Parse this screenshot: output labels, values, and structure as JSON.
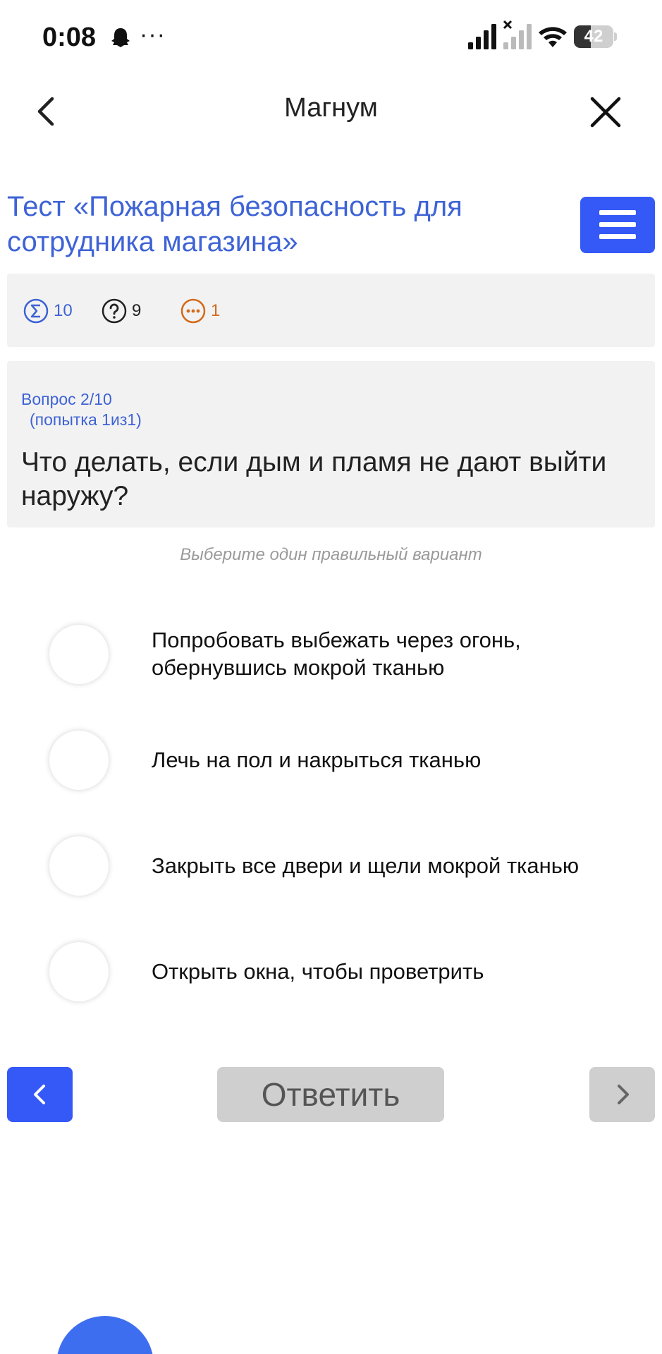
{
  "status_bar": {
    "time": "0:08",
    "more": "···",
    "battery_level": "42",
    "battery_fraction": 0.42,
    "icons": [
      "ghost-icon",
      "signal-icon",
      "no-signal-icon",
      "wifi-icon",
      "battery-icon"
    ]
  },
  "nav": {
    "title": "Магнум",
    "back_icon": "chevron-left-icon",
    "close_icon": "close-icon"
  },
  "test": {
    "title": " Тест «Пожарная безопасность для сотрудника магазина»",
    "menu_icon": "hamburger-icon"
  },
  "stats": {
    "total": "10",
    "unanswered": "9",
    "remaining": "1",
    "colors": {
      "total": "#3e63d6",
      "unanswered": "#222222",
      "remaining": "#d36a1a"
    }
  },
  "question": {
    "number": "Вопрос 2/10",
    "attempt": "(попытка 1из1)",
    "text": "Что делать, если дым и пламя не дают выйти наружу?"
  },
  "hint": "Выберите один правильный вариант",
  "options": [
    {
      "label": "Попробовать выбежать через огонь, обернувшись мокрой тканью",
      "selected": false
    },
    {
      "label": "Лечь на пол и накрыться тканью",
      "selected": false
    },
    {
      "label": "Закрыть все двери и щели мокрой тканью",
      "selected": false
    },
    {
      "label": "Открыть окна, чтобы проветрить",
      "selected": false
    }
  ],
  "footer": {
    "answer_label": "Ответить",
    "prev_icon": "chevron-left-icon",
    "next_icon": "chevron-right-icon"
  },
  "colors": {
    "accent": "#3559f7",
    "link_blue": "#3e63d6",
    "panel_bg": "#f2f2f2",
    "disabled": "#cfcfcf"
  }
}
